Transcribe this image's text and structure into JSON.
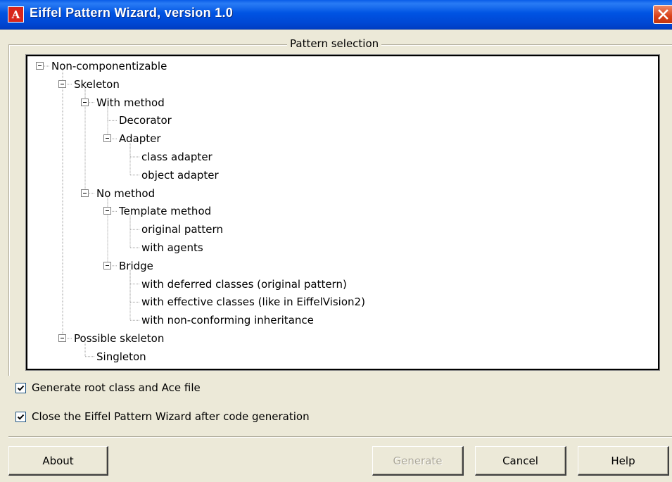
{
  "window": {
    "title": "Eiffel Pattern Wizard, version 1.0",
    "icon": "app-logo-icon",
    "icon_glyph": "A",
    "close_icon": "close-icon"
  },
  "pattern_selection": {
    "label": "Pattern selection",
    "tree": [
      {
        "label": "Non-componentizable",
        "level": 0,
        "expandable": true
      },
      {
        "label": "Skeleton",
        "level": 1,
        "expandable": true
      },
      {
        "label": "With method",
        "level": 2,
        "expandable": true
      },
      {
        "label": "Decorator",
        "level": 3,
        "expandable": false
      },
      {
        "label": "Adapter",
        "level": 3,
        "expandable": true
      },
      {
        "label": "class adapter",
        "level": 4,
        "expandable": false
      },
      {
        "label": "object adapter",
        "level": 4,
        "expandable": false
      },
      {
        "label": "No method",
        "level": 2,
        "expandable": true
      },
      {
        "label": "Template method",
        "level": 3,
        "expandable": true
      },
      {
        "label": "original pattern",
        "level": 4,
        "expandable": false
      },
      {
        "label": "with agents",
        "level": 4,
        "expandable": false
      },
      {
        "label": "Bridge",
        "level": 3,
        "expandable": true
      },
      {
        "label": "with deferred classes (original pattern)",
        "level": 4,
        "expandable": false
      },
      {
        "label": "with effective classes (like in EiffelVision2)",
        "level": 4,
        "expandable": false
      },
      {
        "label": "with non-conforming inheritance",
        "level": 4,
        "expandable": false
      },
      {
        "label": "Possible skeleton",
        "level": 1,
        "expandable": true
      },
      {
        "label": "Singleton",
        "level": 2,
        "expandable": false
      }
    ]
  },
  "options": {
    "generate_root": {
      "label": "Generate root class and Ace file",
      "checked": true
    },
    "close_after": {
      "label": "Close the Eiffel Pattern Wizard after code generation",
      "checked": true
    }
  },
  "buttons": {
    "about": "About",
    "generate": "Generate",
    "cancel": "Cancel",
    "help": "Help"
  }
}
